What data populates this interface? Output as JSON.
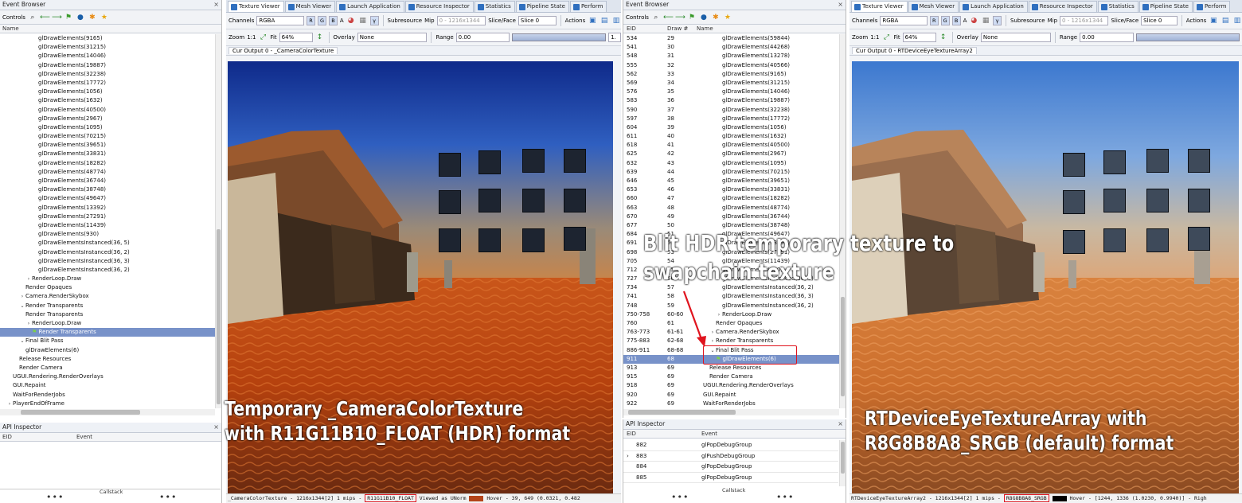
{
  "left_event_browser": {
    "title": "Event Browser",
    "controls_label": "Controls",
    "column_name": "Name",
    "rows": [
      {
        "label": "glDrawElements(9165)",
        "indent": 2
      },
      {
        "label": "glDrawElements(31215)",
        "indent": 2
      },
      {
        "label": "glDrawElements(14046)",
        "indent": 2
      },
      {
        "label": "glDrawElements(19887)",
        "indent": 2
      },
      {
        "label": "glDrawElements(32238)",
        "indent": 2
      },
      {
        "label": "glDrawElements(17772)",
        "indent": 2
      },
      {
        "label": "glDrawElements(1056)",
        "indent": 2
      },
      {
        "label": "glDrawElements(1632)",
        "indent": 2
      },
      {
        "label": "glDrawElements(40500)",
        "indent": 2
      },
      {
        "label": "glDrawElements(2967)",
        "indent": 2
      },
      {
        "label": "glDrawElements(1095)",
        "indent": 2
      },
      {
        "label": "glDrawElements(70215)",
        "indent": 2
      },
      {
        "label": "glDrawElements(39651)",
        "indent": 2
      },
      {
        "label": "glDrawElements(33831)",
        "indent": 2
      },
      {
        "label": "glDrawElements(18282)",
        "indent": 2
      },
      {
        "label": "glDrawElements(48774)",
        "indent": 2
      },
      {
        "label": "glDrawElements(36744)",
        "indent": 2
      },
      {
        "label": "glDrawElements(38748)",
        "indent": 2
      },
      {
        "label": "glDrawElements(49647)",
        "indent": 2
      },
      {
        "label": "glDrawElements(13392)",
        "indent": 2
      },
      {
        "label": "glDrawElements(27291)",
        "indent": 2
      },
      {
        "label": "glDrawElements(11439)",
        "indent": 2
      },
      {
        "label": "glDrawElements(930)",
        "indent": 2
      },
      {
        "label": "glDrawElementsInstanced(36, 5)",
        "indent": 2
      },
      {
        "label": "glDrawElementsInstanced(36, 2)",
        "indent": 2
      },
      {
        "label": "glDrawElementsInstanced(36, 3)",
        "indent": 2
      },
      {
        "label": "glDrawElementsInstanced(36, 2)",
        "indent": 2
      },
      {
        "label": "RenderLoop.Draw",
        "indent": 1,
        "caret": "›"
      },
      {
        "label": "Render Opaques",
        "indent": 1
      },
      {
        "label": "Camera.RenderSkybox",
        "indent": 0.5,
        "caret": "›"
      },
      {
        "label": "Render Transparents",
        "indent": 0.5,
        "caret": "⌄"
      },
      {
        "label": "Render Transparents",
        "indent": 1
      },
      {
        "label": "RenderLoop.Draw",
        "indent": 1,
        "caret": "›"
      },
      {
        "label": "Render Transparents",
        "indent": 1.5,
        "selected": true,
        "flag": true
      },
      {
        "label": "Final Blit Pass",
        "indent": 0.5,
        "caret": "⌄"
      },
      {
        "label": "glDrawElements(6)",
        "indent": 1
      },
      {
        "label": "Release Resources",
        "indent": 0.5
      },
      {
        "label": "Render Camera",
        "indent": 0.5
      },
      {
        "label": "UGUI.Rendering.RenderOverlays",
        "indent": 0
      },
      {
        "label": "GUI.Repaint",
        "indent": 0
      },
      {
        "label": "WaitForRenderJobs",
        "indent": 0
      },
      {
        "label": "PlayerEndOfFrame",
        "indent": -0.5,
        "caret": "›"
      }
    ]
  },
  "left_api_inspector": {
    "title": "API Inspector",
    "col_eid": "EID",
    "col_event": "Event",
    "callstack": "Callstack",
    "dots": "•••"
  },
  "tabs": [
    "Texture Viewer",
    "Mesh Viewer",
    "Launch Application",
    "Resource Inspector",
    "Statistics",
    "Pipeline State",
    "Perform"
  ],
  "tex_toolbar": {
    "channels_label": "Channels",
    "channels_value": "RGBA",
    "ch_r": "R",
    "ch_g": "G",
    "ch_b": "B",
    "ch_a": "A",
    "ch_gamma": "γ",
    "subresource_label": "Subresource",
    "mip_label": "Mip",
    "mip_value": "0 - 1216x1344",
    "slice_label": "Slice/Face",
    "slice_value": "Slice 0",
    "actions_label": "Actions",
    "zoom_label": "Zoom",
    "zoom_11": "1:1",
    "fit_label": "Fit",
    "zoom_value": "64%",
    "overlay_label": "Overlay",
    "overlay_value": "None",
    "range_label": "Range",
    "range_min": "0.00",
    "range_max": "1."
  },
  "left_viewer": {
    "subtab": "Cur Output 0 - _CameraColorTexture",
    "status_pre": "_CameraColorTexture - 1216x1344[2] 1 mips - ",
    "status_format": "R11G11B10_FLOAT",
    "status_post": " Viewed as UNorm",
    "status_hover": "Hover -    39,  649 (0.0321, 0.482"
  },
  "mid_event_browser": {
    "title": "Event Browser",
    "controls_label": "Controls",
    "col_eid": "EID",
    "col_draw": "Draw #",
    "col_name": "Name",
    "rows": [
      {
        "eid": "534",
        "draw": "29",
        "label": "glDrawElements(59844)",
        "indent": 3
      },
      {
        "eid": "541",
        "draw": "30",
        "label": "glDrawElements(44268)",
        "indent": 3
      },
      {
        "eid": "548",
        "draw": "31",
        "label": "glDrawElements(13278)",
        "indent": 3
      },
      {
        "eid": "555",
        "draw": "32",
        "label": "glDrawElements(40566)",
        "indent": 3
      },
      {
        "eid": "562",
        "draw": "33",
        "label": "glDrawElements(9165)",
        "indent": 3
      },
      {
        "eid": "569",
        "draw": "34",
        "label": "glDrawElements(31215)",
        "indent": 3
      },
      {
        "eid": "576",
        "draw": "35",
        "label": "glDrawElements(14046)",
        "indent": 3
      },
      {
        "eid": "583",
        "draw": "36",
        "label": "glDrawElements(19887)",
        "indent": 3
      },
      {
        "eid": "590",
        "draw": "37",
        "label": "glDrawElements(32238)",
        "indent": 3
      },
      {
        "eid": "597",
        "draw": "38",
        "label": "glDrawElements(17772)",
        "indent": 3
      },
      {
        "eid": "604",
        "draw": "39",
        "label": "glDrawElements(1056)",
        "indent": 3
      },
      {
        "eid": "611",
        "draw": "40",
        "label": "glDrawElements(1632)",
        "indent": 3
      },
      {
        "eid": "618",
        "draw": "41",
        "label": "glDrawElements(40500)",
        "indent": 3
      },
      {
        "eid": "625",
        "draw": "42",
        "label": "glDrawElements(2967)",
        "indent": 3
      },
      {
        "eid": "632",
        "draw": "43",
        "label": "glDrawElements(1095)",
        "indent": 3
      },
      {
        "eid": "639",
        "draw": "44",
        "label": "glDrawElements(70215)",
        "indent": 3
      },
      {
        "eid": "646",
        "draw": "45",
        "label": "glDrawElements(39651)",
        "indent": 3
      },
      {
        "eid": "653",
        "draw": "46",
        "label": "glDrawElements(33831)",
        "indent": 3
      },
      {
        "eid": "660",
        "draw": "47",
        "label": "glDrawElements(18282)",
        "indent": 3
      },
      {
        "eid": "663",
        "draw": "48",
        "label": "glDrawElements(48774)",
        "indent": 3
      },
      {
        "eid": "670",
        "draw": "49",
        "label": "glDrawElements(36744)",
        "indent": 3
      },
      {
        "eid": "677",
        "draw": "50",
        "label": "glDrawElements(38748)",
        "indent": 3
      },
      {
        "eid": "684",
        "draw": "51",
        "label": "glDrawElements(49647)",
        "indent": 3
      },
      {
        "eid": "691",
        "draw": "52",
        "label": "glDrawElements(13392)",
        "indent": 3
      },
      {
        "eid": "698",
        "draw": "53",
        "label": "glDrawElements(27291)",
        "indent": 3
      },
      {
        "eid": "705",
        "draw": "54",
        "label": "glDrawElements(11439)",
        "indent": 3
      },
      {
        "eid": "712",
        "draw": "55",
        "label": "glDrawElements(930)",
        "indent": 3
      },
      {
        "eid": "727",
        "draw": "56",
        "label": "glDrawElementsInstanced(36, 5)",
        "indent": 3
      },
      {
        "eid": "734",
        "draw": "57",
        "label": "glDrawElementsInstanced(36, 2)",
        "indent": 3
      },
      {
        "eid": "741",
        "draw": "58",
        "label": "glDrawElementsInstanced(36, 3)",
        "indent": 3
      },
      {
        "eid": "748",
        "draw": "59",
        "label": "glDrawElementsInstanced(36, 2)",
        "indent": 3
      },
      {
        "eid": "750-758",
        "draw": "60-60",
        "label": "RenderLoop.Draw",
        "indent": 2,
        "caret": "›"
      },
      {
        "eid": "760",
        "draw": "61",
        "label": "Render Opaques",
        "indent": 2
      },
      {
        "eid": "763-773",
        "draw": "61-61",
        "label": "Camera.RenderSkybox",
        "indent": 1,
        "caret": "›"
      },
      {
        "eid": "775-883",
        "draw": "62-68",
        "label": "Render Transparents",
        "indent": 1,
        "caret": "›"
      },
      {
        "eid": "886-911",
        "draw": "68-68",
        "label": "Final Blit Pass",
        "indent": 1,
        "caret": "⌄",
        "box": true
      },
      {
        "eid": "911",
        "draw": "68",
        "label": "glDrawElements(6)",
        "indent": 2,
        "selected": true,
        "flag": true,
        "box": true
      },
      {
        "eid": "913",
        "draw": "69",
        "label": "Release Resources",
        "indent": 1
      },
      {
        "eid": "915",
        "draw": "69",
        "label": "Render Camera",
        "indent": 1
      },
      {
        "eid": "918",
        "draw": "69",
        "label": "UGUI.Rendering.RenderOverlays",
        "indent": 0
      },
      {
        "eid": "920",
        "draw": "69",
        "label": "GUI.Repaint",
        "indent": 0
      },
      {
        "eid": "922",
        "draw": "69",
        "label": "WaitForRenderJobs",
        "indent": 0
      }
    ]
  },
  "mid_api_inspector": {
    "title": "API Inspector",
    "col_eid": "EID",
    "col_event": "Event",
    "rows": [
      {
        "eid": "882",
        "event": "glPopDebugGroup",
        "caret": ""
      },
      {
        "eid": "883",
        "event": "glPushDebugGroup",
        "caret": "›"
      },
      {
        "eid": "884",
        "event": "glPopDebugGroup",
        "caret": ""
      },
      {
        "eid": "885",
        "event": "glPopDebugGroup",
        "caret": ""
      }
    ],
    "callstack": "Callstack",
    "dots": "•••"
  },
  "right_viewer": {
    "subtab": "Cur Output 0 - RTDeviceEyeTextureArray2",
    "status_pre": "RTDeviceEyeTextureArray2 - 1216x1344[2] 1 mips - ",
    "status_format": "R8G8B8A8_SRGB",
    "status_hover": "Hover - [1244, 1336 (1.0230, 0.9940)] - Righ"
  },
  "annotations": {
    "left_line1": "Temporary _CameraColorTexture",
    "left_line2": "with R11G11B10_FLOAT (HDR) format",
    "mid_line1": "Blit HDR temporary texture to",
    "mid_line2": "swapchain texture",
    "right_line1": "RTDeviceEyeTextureArray with",
    "right_line2": "R8G8B8A8_SRGB (default) format"
  },
  "colors": {
    "selection": "#7892c9",
    "highlight_red": "#e0141e",
    "tab_icon": "#2f6fbf"
  }
}
